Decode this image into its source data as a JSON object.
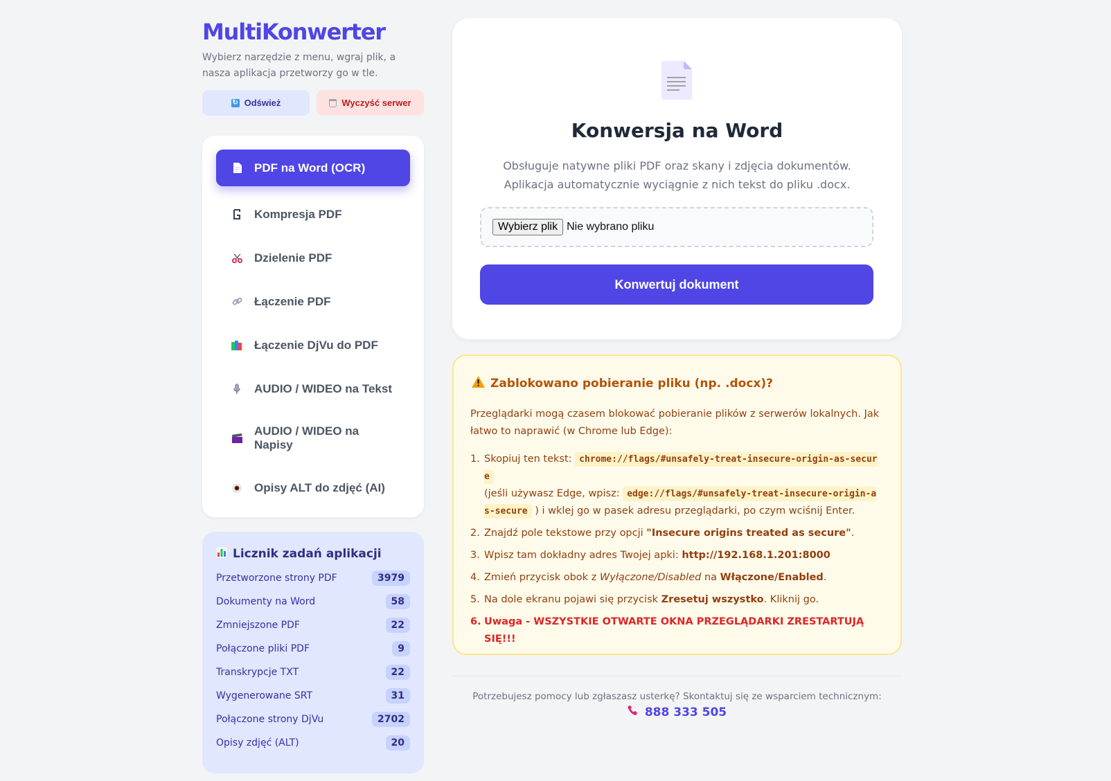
{
  "app": {
    "title": "MultiKonwerter",
    "subtitle": "Wybierz narzędzie z menu, wgraj plik, a nasza aplikacja przetworzy go w tle.",
    "refresh_label": "Odśwież",
    "clear_label": "Wyczyść serwer"
  },
  "menu": {
    "items": [
      {
        "label": "PDF na Word (OCR)",
        "icon": "document-icon",
        "active": true
      },
      {
        "label": "Kompresja PDF",
        "icon": "clamp-icon"
      },
      {
        "label": "Dzielenie PDF",
        "icon": "scissors-icon"
      },
      {
        "label": "Łączenie PDF",
        "icon": "link-icon"
      },
      {
        "label": "Łączenie DjVu do PDF",
        "icon": "books-icon"
      },
      {
        "label": "AUDIO / WIDEO na Tekst",
        "icon": "microphone-icon"
      },
      {
        "label": "AUDIO / WIDEO na Napisy",
        "icon": "clapperboard-icon"
      },
      {
        "label": "Opisy ALT do zdjęć (AI)",
        "icon": "eye-icon"
      }
    ]
  },
  "stats": {
    "title": "Licznik zadań aplikacji",
    "rows": [
      {
        "label": "Przetworzone strony PDF",
        "value": "3979"
      },
      {
        "label": "Dokumenty na Word",
        "value": "58"
      },
      {
        "label": "Zmniejszone PDF",
        "value": "22"
      },
      {
        "label": "Połączone pliki PDF",
        "value": "9"
      },
      {
        "label": "Transkrypcje TXT",
        "value": "22"
      },
      {
        "label": "Wygenerowane SRT",
        "value": "31"
      },
      {
        "label": "Połączone strony DjVu",
        "value": "2702"
      },
      {
        "label": "Opisy zdjęć (ALT)",
        "value": "20"
      }
    ]
  },
  "main": {
    "title": "Konwersja na Word",
    "description": "Obsługuje natywne pliki PDF oraz skany i zdjęcia dokumentów. Aplikacja automatycznie wyciągnie z nich tekst do pliku .docx.",
    "file_button": "Wybierz plik",
    "file_status": "Nie wybrano pliku",
    "convert_label": "Konwertuj dokument"
  },
  "warning": {
    "title": "Zablokowano pobieranie pliku (np. .docx)?",
    "intro": "Przeglądarki mogą czasem blokować pobieranie plików z serwerów lokalnych. Jak łatwo to naprawić (w Chrome lub Edge):",
    "step1_prefix": "Skopiuj ten tekst:",
    "step1_code": "chrome://flags/#unsafely-treat-insecure-origin-as-secure",
    "step1_edge_prefix": "(jeśli używasz Edge, wpisz:",
    "step1_edge_code": "edge://flags/#unsafely-treat-insecure-origin-as-secure",
    "step1_suffix": ") i wklej go w pasek adresu przeglądarki, po czym wciśnij Enter.",
    "step2_prefix": "Znajdź pole tekstowe przy opcji",
    "step2_bold": "\"Insecure origins treated as secure\"",
    "step2_suffix": ".",
    "step3_prefix": "Wpisz tam dokładny adres Twojej apki:",
    "step3_bold": "http://192.168.1.201:8000",
    "step4_prefix": "Zmień przycisk obok z",
    "step4_italic": "Wyłączone/Disabled",
    "step4_mid": "na",
    "step4_bold": "Włączone/Enabled",
    "step4_suffix": ".",
    "step5_prefix": "Na dole ekranu pojawi się przycisk",
    "step5_bold": "Zresetuj wszystko",
    "step5_suffix": ". Kliknij go.",
    "step6_num": "6.",
    "step6": "Uwaga - WSZYSTKIE OTWARTE OKNA PRZEGLĄDARKI ZRESTARTUJĄ SIĘ!!!"
  },
  "footer": {
    "text": "Potrzebujesz pomocy lub zgłaszasz usterkę? Skontaktuj się ze wsparciem technicznym:",
    "phone": "888 333 505"
  },
  "colors": {
    "accent": "#4f46e5",
    "background": "#f3f4f6",
    "warning_bg": "#fffbeb",
    "danger": "#dc2626"
  }
}
